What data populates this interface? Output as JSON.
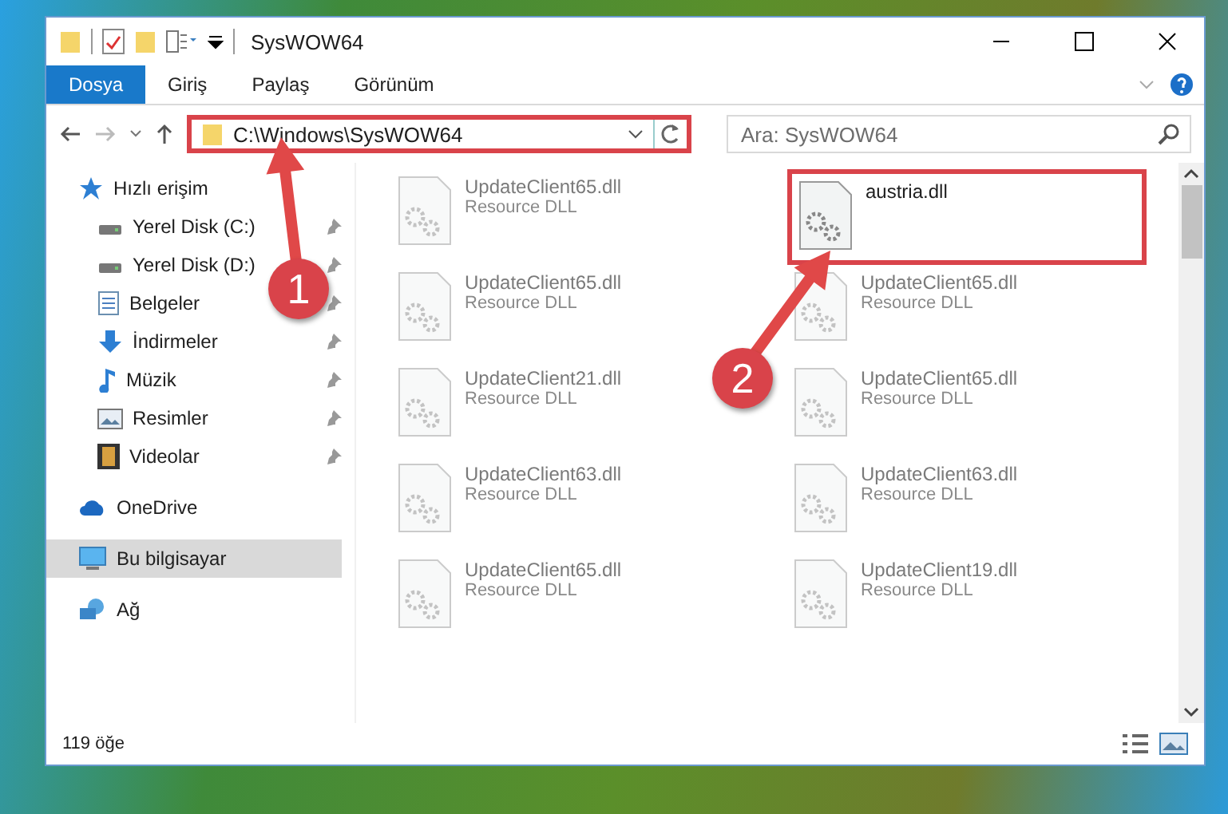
{
  "window": {
    "title": "SysWOW64"
  },
  "ribbon": {
    "tabs": [
      {
        "label": "Dosya",
        "selected": true
      },
      {
        "label": "Giriş",
        "selected": false
      },
      {
        "label": "Paylaş",
        "selected": false
      },
      {
        "label": "Görünüm",
        "selected": false
      }
    ]
  },
  "address": {
    "path": "C:\\Windows\\SysWOW64",
    "highlighted": true
  },
  "search": {
    "placeholder": "Ara: SysWOW64"
  },
  "sidebar": {
    "items": [
      {
        "label": "Hızlı erişim",
        "kind": "quick",
        "selected": false,
        "children": [
          {
            "label": "Yerel Disk (C:)",
            "kind": "drive",
            "selected": false,
            "pinned": true
          },
          {
            "label": "Yerel Disk (D:)",
            "kind": "drive",
            "selected": false,
            "pinned": true
          },
          {
            "label": "Belgeler",
            "kind": "documents",
            "selected": false,
            "pinned": true
          },
          {
            "label": "İndirmeler",
            "kind": "downloads",
            "selected": false,
            "pinned": true
          },
          {
            "label": "Müzik",
            "kind": "music",
            "selected": false,
            "pinned": true
          },
          {
            "label": "Resimler",
            "kind": "pictures",
            "selected": false,
            "pinned": true
          },
          {
            "label": "Videolar",
            "kind": "videos",
            "selected": false,
            "pinned": true
          }
        ]
      },
      {
        "label": "OneDrive",
        "kind": "cloud",
        "selected": false
      },
      {
        "label": "Bu bilgisayar",
        "kind": "computer",
        "selected": true
      },
      {
        "label": "Ağ",
        "kind": "network",
        "selected": false
      }
    ]
  },
  "files": [
    {
      "name": "UpdateClient65.dll",
      "type": "Resource DLL",
      "dimmed": true,
      "highlighted": false
    },
    {
      "name": "austria.dll",
      "dimmed": false,
      "highlighted": true
    },
    {
      "name": "UpdateClient65.dll",
      "type": "Resource DLL",
      "dimmed": true,
      "highlighted": false
    },
    {
      "name": "UpdateClient65.dll",
      "type": "Resource DLL",
      "dimmed": true,
      "highlighted": false
    },
    {
      "name": "UpdateClient21.dll",
      "type": "Resource DLL",
      "dimmed": true,
      "highlighted": false
    },
    {
      "name": "UpdateClient65.dll",
      "type": "Resource DLL",
      "dimmed": true,
      "highlighted": false
    },
    {
      "name": "UpdateClient63.dll",
      "type": "Resource DLL",
      "dimmed": true,
      "highlighted": false
    },
    {
      "name": "UpdateClient63.dll",
      "type": "Resource DLL",
      "dimmed": true,
      "highlighted": false
    },
    {
      "name": "UpdateClient65.dll",
      "type": "Resource DLL",
      "dimmed": true,
      "highlighted": false
    },
    {
      "name": "UpdateClient19.dll",
      "type": "Resource DLL",
      "dimmed": true,
      "highlighted": false
    }
  ],
  "status_bar": {
    "item_count": "119 öğe"
  },
  "callouts": [
    {
      "number": "1"
    },
    {
      "number": "2"
    }
  ]
}
